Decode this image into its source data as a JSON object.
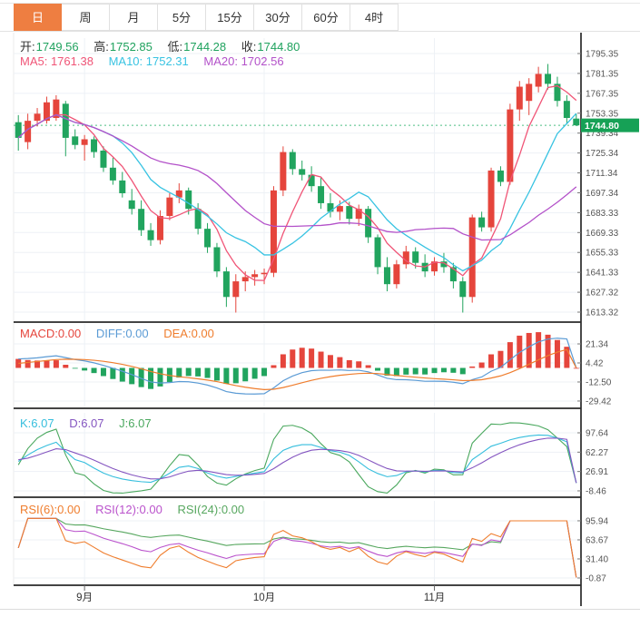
{
  "toolbar": {
    "tabs": [
      {
        "id": "day",
        "label": "日",
        "active": true
      },
      {
        "id": "week",
        "label": "周",
        "active": false
      },
      {
        "id": "month",
        "label": "月",
        "active": false
      },
      {
        "id": "5min",
        "label": "5分",
        "active": false
      },
      {
        "id": "15min",
        "label": "15分",
        "active": false
      },
      {
        "id": "30min",
        "label": "30分",
        "active": false
      },
      {
        "id": "60min",
        "label": "60分",
        "active": false
      },
      {
        "id": "4hour",
        "label": "4时",
        "active": false
      }
    ]
  },
  "quote": {
    "open_label": "开:",
    "open_value": "1749.56",
    "high_label": "高:",
    "high_value": "1752.85",
    "low_label": "低:",
    "low_value": "1744.28",
    "close_label": "收:",
    "close_value": "1744.80"
  },
  "ma_readout": {
    "ma5": "MA5: 1761.38",
    "ma10": "MA10: 1752.31",
    "ma20": "MA20: 1702.56"
  },
  "macd_readout": {
    "macd": "MACD:0.00",
    "diff": "DIFF:0.00",
    "dea": "DEA:0.00"
  },
  "kdj_readout": {
    "k": "K:6.07",
    "d": "D:6.07",
    "j": "J:6.07"
  },
  "rsi_readout": {
    "rsi6": "RSI(6):0.00",
    "rsi12": "RSI(12):0.00",
    "rsi24": "RSI(24):0.00"
  },
  "colors": {
    "up": "#e5453c",
    "down": "#21a45e",
    "ma5": "#f05577",
    "ma10": "#38c3e2",
    "ma20": "#b351c9",
    "diff": "#5b9bd5",
    "dea": "#ef7d2d",
    "k": "#35bedd",
    "d": "#8455c0",
    "j": "#4aa85e",
    "rsi6": "#ef7d2d",
    "rsi12": "#ba52cc",
    "rsi24": "#57a75f",
    "accent_tab": "#ee7e41",
    "badge": "#16a156",
    "dotted_line": "#4cbd82",
    "grid": "#edf1f6",
    "axis_dark": "#2a2a2a",
    "label": "#555555"
  },
  "chart_data": {
    "type": "candlestick",
    "title": "",
    "legend": [
      "MA5",
      "MA10",
      "MA20",
      "MACD",
      "DIFF",
      "DEA",
      "K",
      "D",
      "J",
      "RSI(6)",
      "RSI(12)",
      "RSI(24)"
    ],
    "x_axis": {
      "month_ticks": [
        {
          "index": 7,
          "label": "9月"
        },
        {
          "index": 26,
          "label": "10月"
        },
        {
          "index": 44,
          "label": "11月"
        }
      ]
    },
    "price_axis": {
      "ticks": [
        "1795.35",
        "1781.35",
        "1767.35",
        "1753.35",
        "1739.34",
        "1725.34",
        "1711.34",
        "1697.34",
        "1683.33",
        "1669.33",
        "1655.33",
        "1641.33",
        "1627.32",
        "1613.32"
      ],
      "range": [
        1606.3,
        1806.2
      ],
      "last_price": 1744.8,
      "last_price_label": "1744.80"
    },
    "candles": [
      [
        1747,
        1752,
        1727,
        1736
      ],
      [
        1733,
        1753,
        1728,
        1748
      ],
      [
        1748,
        1757,
        1744,
        1753
      ],
      [
        1748,
        1765,
        1746,
        1761
      ],
      [
        1750,
        1766,
        1748,
        1763
      ],
      [
        1760,
        1762,
        1723,
        1736
      ],
      [
        1737,
        1742,
        1728,
        1731
      ],
      [
        1731,
        1738,
        1720,
        1735
      ],
      [
        1735,
        1737,
        1722,
        1726
      ],
      [
        1727,
        1730,
        1712,
        1715
      ],
      [
        1715,
        1722,
        1703,
        1706
      ],
      [
        1706,
        1712,
        1694,
        1697
      ],
      [
        1692,
        1700,
        1682,
        1686
      ],
      [
        1686,
        1692,
        1667,
        1671
      ],
      [
        1671,
        1676,
        1660,
        1664
      ],
      [
        1664,
        1685,
        1661,
        1681
      ],
      [
        1681,
        1697,
        1678,
        1694
      ],
      [
        1694,
        1704,
        1690,
        1699
      ],
      [
        1699,
        1701,
        1682,
        1686
      ],
      [
        1686,
        1690,
        1668,
        1672
      ],
      [
        1672,
        1676,
        1655,
        1659
      ],
      [
        1659,
        1662,
        1638,
        1642
      ],
      [
        1642,
        1645,
        1617,
        1624
      ],
      [
        1624,
        1640,
        1613,
        1635
      ],
      [
        1635,
        1642,
        1628,
        1638
      ],
      [
        1638,
        1643,
        1632,
        1640
      ],
      [
        1640,
        1644,
        1633,
        1641
      ],
      [
        1641,
        1702,
        1638,
        1699
      ],
      [
        1699,
        1730,
        1695,
        1726
      ],
      [
        1726,
        1728,
        1710,
        1714
      ],
      [
        1714,
        1720,
        1706,
        1710
      ],
      [
        1710,
        1716,
        1698,
        1702
      ],
      [
        1702,
        1708,
        1686,
        1690
      ],
      [
        1690,
        1697,
        1680,
        1684
      ],
      [
        1684,
        1692,
        1678,
        1688
      ],
      [
        1688,
        1691,
        1675,
        1679
      ],
      [
        1679,
        1689,
        1674,
        1686
      ],
      [
        1686,
        1688,
        1662,
        1666
      ],
      [
        1666,
        1668,
        1640,
        1645
      ],
      [
        1645,
        1652,
        1628,
        1633
      ],
      [
        1633,
        1650,
        1630,
        1647
      ],
      [
        1647,
        1660,
        1644,
        1656
      ],
      [
        1656,
        1659,
        1644,
        1648
      ],
      [
        1648,
        1654,
        1638,
        1642
      ],
      [
        1642,
        1652,
        1639,
        1649
      ],
      [
        1649,
        1655,
        1641,
        1645
      ],
      [
        1645,
        1648,
        1630,
        1635
      ],
      [
        1635,
        1638,
        1613,
        1624
      ],
      [
        1624,
        1682,
        1620,
        1680
      ],
      [
        1680,
        1684,
        1670,
        1673
      ],
      [
        1673,
        1715,
        1670,
        1713
      ],
      [
        1713,
        1716,
        1702,
        1705
      ],
      [
        1705,
        1760,
        1703,
        1756
      ],
      [
        1756,
        1776,
        1748,
        1772
      ],
      [
        1762,
        1778,
        1752,
        1774
      ],
      [
        1772,
        1786,
        1768,
        1781
      ],
      [
        1781,
        1788,
        1770,
        1774
      ],
      [
        1774,
        1779,
        1758,
        1762
      ],
      [
        1762,
        1766,
        1746,
        1750
      ],
      [
        1749.56,
        1752.85,
        1744.28,
        1744.8
      ]
    ],
    "ma_periods": [
      5,
      10,
      20
    ],
    "macd": {
      "ticks": [
        "21.34",
        "4.42",
        "-12.50",
        "-29.42"
      ],
      "range": [
        -35.9,
        39.1
      ],
      "final": 0
    },
    "kdj": {
      "ticks": [
        "97.64",
        "62.27",
        "26.91",
        "-8.46"
      ],
      "range": [
        -20.1,
        134.1
      ],
      "final": 6.07
    },
    "rsi": {
      "ticks": [
        "95.94",
        "63.67",
        "31.40",
        "-0.87"
      ],
      "range": [
        -13.2,
        129.7
      ],
      "periods": [
        6,
        12,
        24
      ],
      "plateau_from": 52,
      "plateau_value": 95.9,
      "final": 0
    }
  }
}
